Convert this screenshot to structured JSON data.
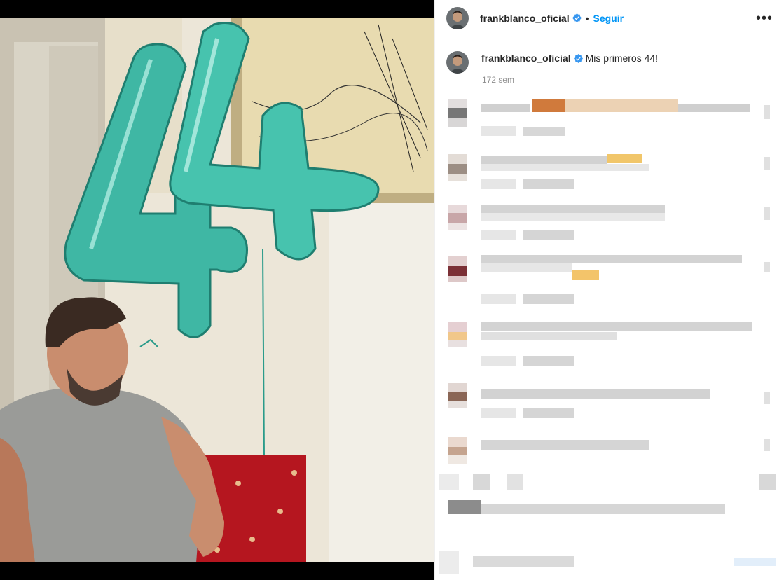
{
  "post": {
    "username": "frankblanco_oficial",
    "follow_label": "Seguir",
    "separator": "•",
    "more_label": "•••",
    "caption": "Mis primeros 44!",
    "time_ago": "172 sem",
    "accent_color": "#0095f6",
    "verified_icon": "verified-badge-icon"
  }
}
